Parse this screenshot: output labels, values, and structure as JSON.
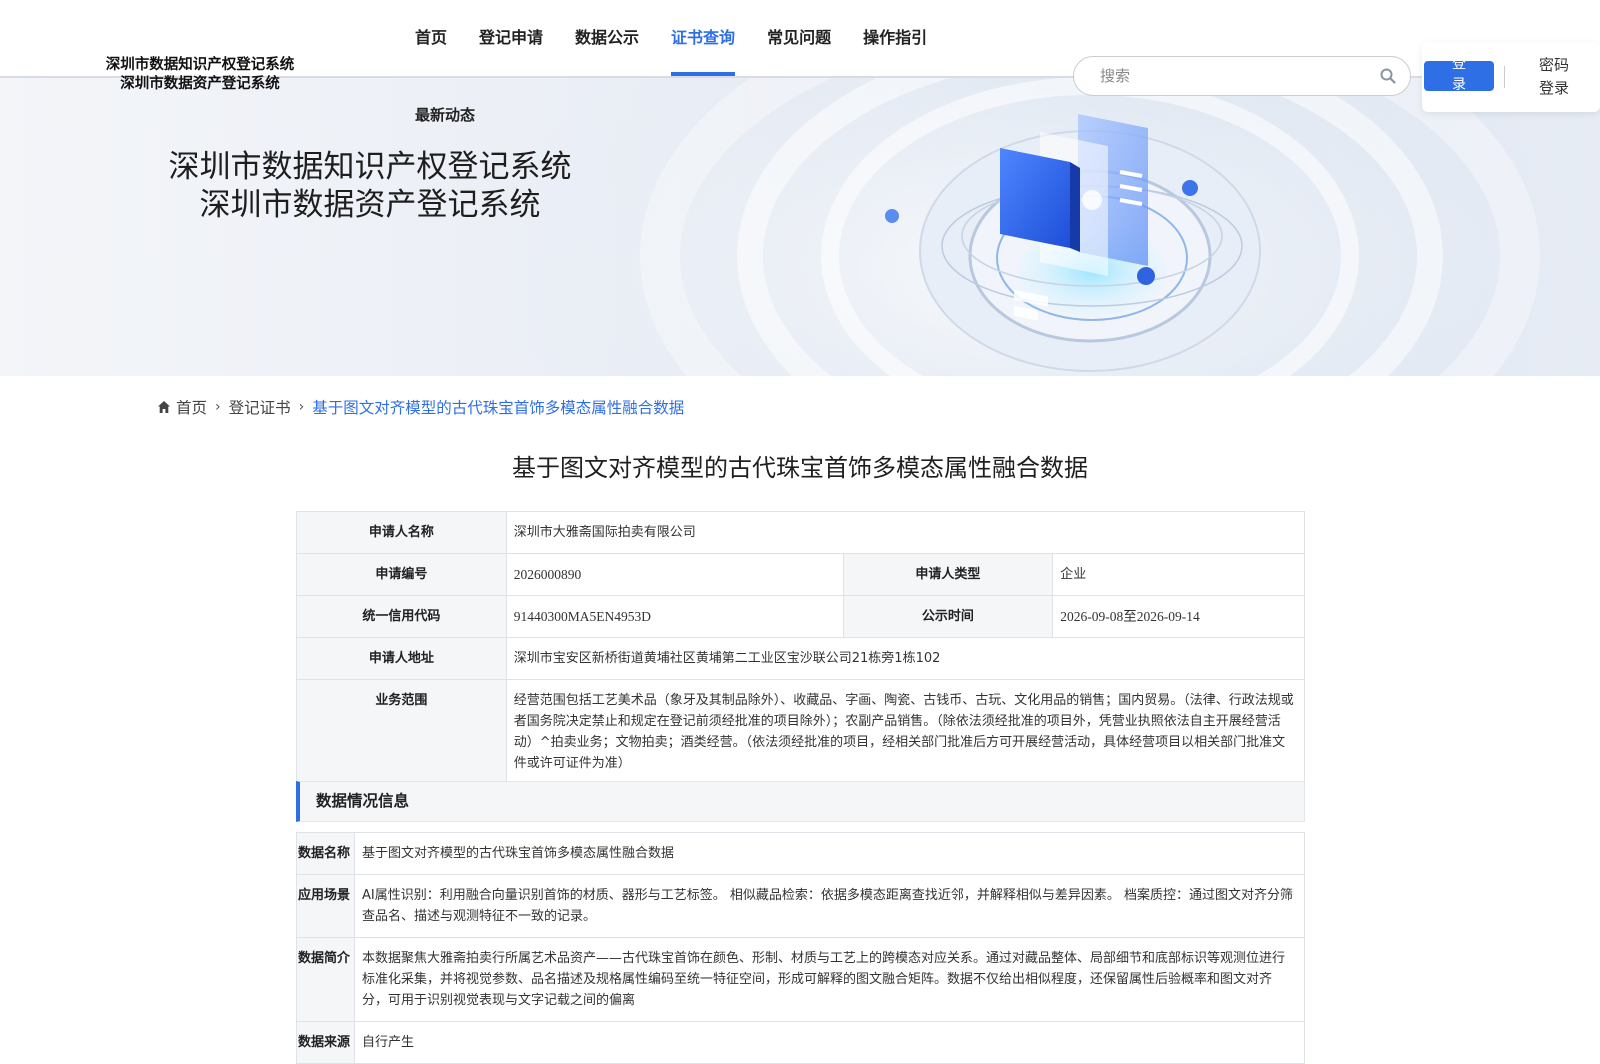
{
  "header": {
    "logo_line1": "深圳市数据知识产权登记系统",
    "logo_line2": "深圳市数据资产登记系统",
    "nav": [
      {
        "label": "首页",
        "active": false
      },
      {
        "label": "登记申请",
        "active": false
      },
      {
        "label": "数据公示",
        "active": false
      },
      {
        "label": "证书查询",
        "active": true
      },
      {
        "label": "常见问题",
        "active": false
      },
      {
        "label": "操作指引",
        "active": false
      }
    ],
    "nav_extra": "最新动态",
    "search_placeholder": "搜索",
    "login_label": "登录",
    "password_login_label": "密码登录"
  },
  "banner": {
    "title_line1": "深圳市数据知识产权登记系统",
    "title_line2": "深圳市数据资产登记系统"
  },
  "breadcrumb": {
    "home": "首页",
    "level1": "登记证书",
    "current": "基于图文对齐模型的古代珠宝首饰多模态属性融合数据"
  },
  "page_title": "基于图文对齐模型的古代珠宝首饰多模态属性融合数据",
  "applicant": {
    "name_label": "申请人名称",
    "name_value": "深圳市大雅斋国际拍卖有限公司",
    "number_label": "申请编号",
    "number_value": "2026000890",
    "type_label": "申请人类型",
    "type_value": "企业",
    "credit_label": "统一信用代码",
    "credit_value": "91440300MA5EN4953D",
    "publicity_label": "公示时间",
    "publicity_value": "2026-09-08至2026-09-14",
    "address_label": "申请人地址",
    "address_value": "深圳市宝安区新桥街道黄埔社区黄埔第二工业区宝沙联公司21栋旁1栋102",
    "scope_label": "业务范围",
    "scope_value": "经营范围包括工艺美术品（象牙及其制品除外）、收藏品、字画、陶瓷、古钱币、古玩、文化用品的销售；国内贸易。（法律、行政法规或者国务院决定禁止和规定在登记前须经批准的项目除外）；农副产品销售。（除依法须经批准的项目外，凭营业执照依法自主开展经营活动）^拍卖业务；文物拍卖；酒类经营。（依法须经批准的项目，经相关部门批准后方可开展经营活动，具体经营项目以相关部门批准文件或许可证件为准）"
  },
  "data_section": {
    "title": "数据情况信息",
    "rows": [
      {
        "label": "数据名称",
        "value": "基于图文对齐模型的古代珠宝首饰多模态属性融合数据"
      },
      {
        "label": "应用场景",
        "value": "AI属性识别：利用融合向量识别首饰的材质、器形与工艺标签。 相似藏品检索：依据多模态距离查找近邻，并解释相似与差异因素。 档案质控：通过图文对齐分筛查品名、描述与观测特征不一致的记录。"
      },
      {
        "label": "数据简介",
        "value": "本数据聚焦大雅斋拍卖行所属艺术品资产——古代珠宝首饰在颜色、形制、材质与工艺上的跨模态对应关系。通过对藏品整体、局部细节和底部标识等观测位进行标准化采集，并将视觉参数、品名描述及规格属性编码至统一特征空间，形成可解释的图文融合矩阵。数据不仅给出相似程度，还保留属性后验概率和图文对齐分，可用于识别视觉表现与文字记载之间的偏离"
      },
      {
        "label": "数据来源",
        "value": "自行产生"
      }
    ]
  },
  "colors": {
    "accent": "#2f6fe6",
    "label_bg": "#f5f6f8",
    "border": "#dfe2e6"
  }
}
